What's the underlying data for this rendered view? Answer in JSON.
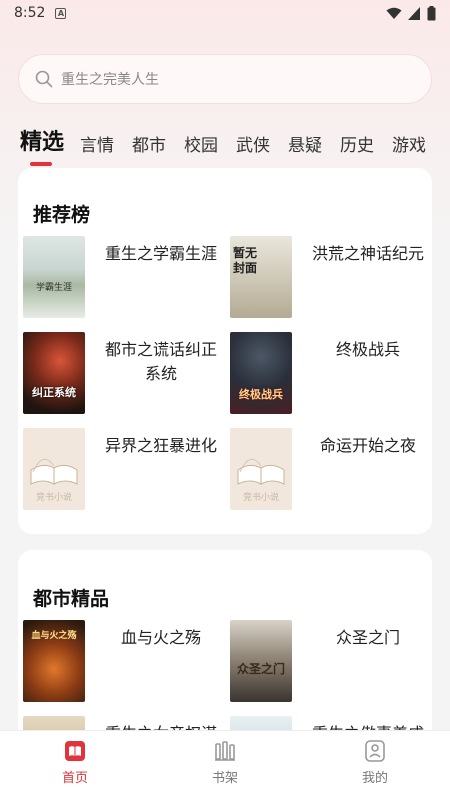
{
  "status": {
    "time": "8:52",
    "notif_letter": "A"
  },
  "search": {
    "placeholder": "重生之完美人生"
  },
  "tabs": [
    "精选",
    "言情",
    "都市",
    "校园",
    "武侠",
    "悬疑",
    "历史",
    "游戏"
  ],
  "sections": [
    {
      "title": "推荐榜",
      "books": [
        {
          "title": "重生之学霸生涯",
          "cover_text": "学霸生涯"
        },
        {
          "title": "洪荒之神话纪元",
          "cover_text": "暂无封面"
        },
        {
          "title": "都市之谎话纠正系统",
          "cover_text": "纠正系统"
        },
        {
          "title": "终极战兵",
          "cover_text": "终极战兵"
        },
        {
          "title": "异界之狂暴进化",
          "cover_text": "竞书小说"
        },
        {
          "title": "命运开始之夜",
          "cover_text": "竞书小说"
        }
      ]
    },
    {
      "title": "都市精品",
      "books": [
        {
          "title": "血与火之殇",
          "cover_text": "血与火之殇"
        },
        {
          "title": "众圣之门",
          "cover_text": "众圣之门"
        },
        {
          "title": "重生之女帝权谋",
          "cover_text": ""
        },
        {
          "title": "重生之傲妻养成",
          "cover_text": ""
        }
      ]
    }
  ],
  "nav": [
    {
      "label": "首页",
      "icon": "book-icon"
    },
    {
      "label": "书架",
      "icon": "bookshelf-icon"
    },
    {
      "label": "我的",
      "icon": "profile-icon"
    }
  ],
  "colors": {
    "accent": "#e0333a",
    "background": "#f4f4f4",
    "card": "#ffffff"
  }
}
